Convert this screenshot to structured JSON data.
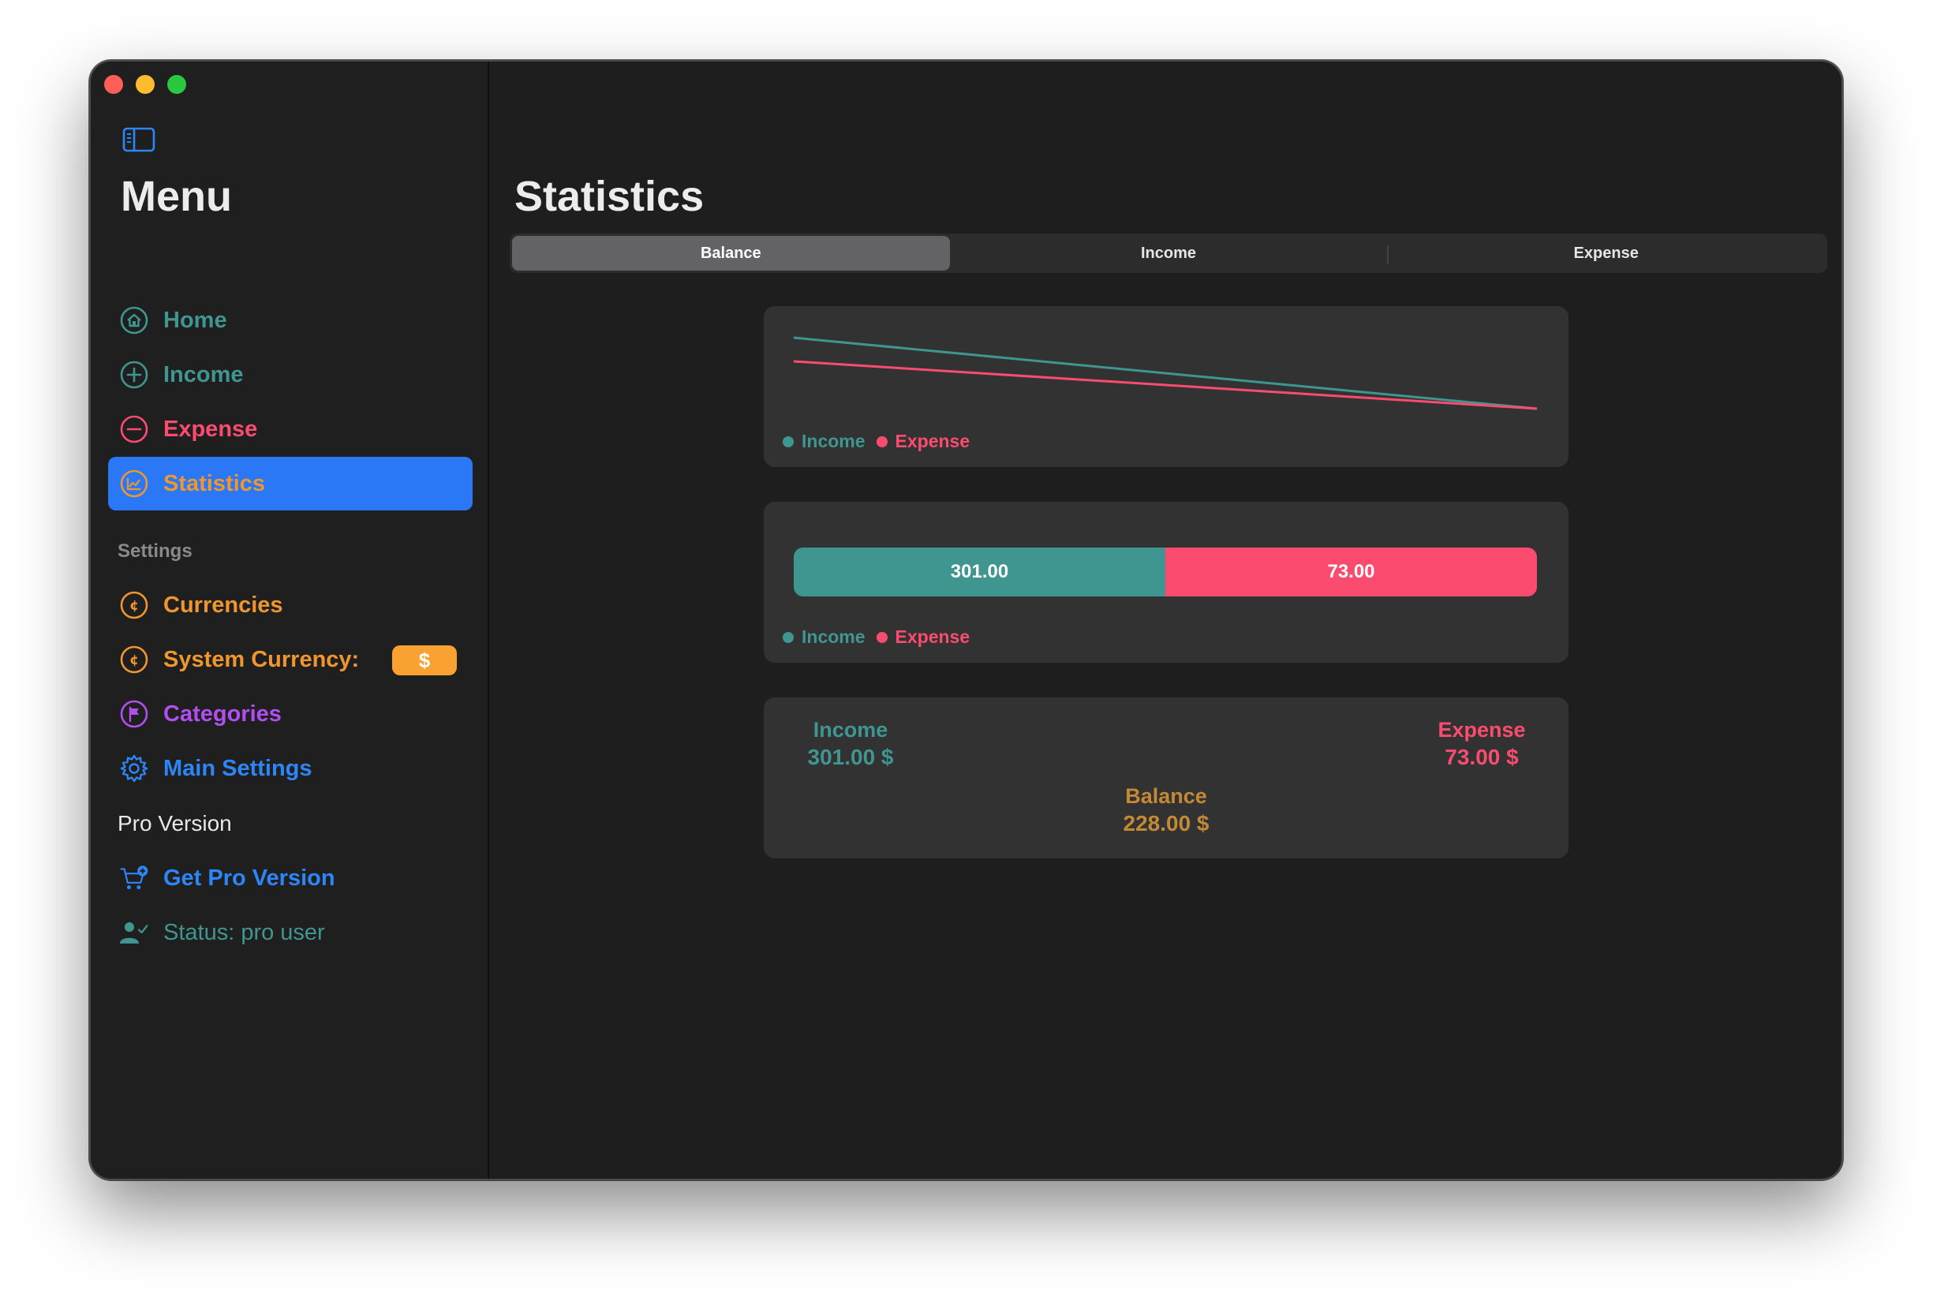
{
  "colors": {
    "income": "#3f9690",
    "expense": "#fb4c70",
    "orange": "#f0962e",
    "purple": "#b04ef0",
    "blue": "#2d86f7",
    "active": "#2a78f5",
    "balance": "#c48935"
  },
  "sidebar": {
    "title": "Menu",
    "items": [
      {
        "label": "Home",
        "icon": "house-circle-icon"
      },
      {
        "label": "Income",
        "icon": "plus-circle-icon"
      },
      {
        "label": "Expense",
        "icon": "minus-circle-icon"
      },
      {
        "label": "Statistics",
        "icon": "chart-circle-icon",
        "active": true
      }
    ],
    "settings_label": "Settings",
    "settings_items": [
      {
        "label": "Currencies",
        "icon": "cent-circle-icon"
      },
      {
        "label": "System Currency:",
        "icon": "cent-circle-icon",
        "badge": "$"
      },
      {
        "label": "Categories",
        "icon": "flag-circle-icon"
      },
      {
        "label": "Main Settings",
        "icon": "gear-icon"
      }
    ],
    "pro_label": "Pro Version",
    "pro_items": [
      {
        "label": "Get Pro Version",
        "icon": "cart-plus-icon"
      },
      {
        "label": "Status: pro user",
        "icon": "person-check-icon"
      }
    ]
  },
  "main": {
    "title": "Statistics",
    "tabs": [
      {
        "label": "Balance",
        "selected": true
      },
      {
        "label": "Income",
        "selected": false
      },
      {
        "label": "Expense",
        "selected": false
      }
    ],
    "legend": {
      "income": "Income",
      "expense": "Expense"
    },
    "summary": {
      "income_label": "Income",
      "income_value": "301.00 $",
      "expense_label": "Expense",
      "expense_value": "73.00 $",
      "balance_label": "Balance",
      "balance_value": "228.00 $"
    }
  },
  "chart_data": [
    {
      "type": "line",
      "x": [
        0,
        1
      ],
      "series": [
        {
          "name": "Income",
          "values": [
            301,
            0
          ]
        },
        {
          "name": "Expense",
          "values": [
            73,
            0
          ]
        }
      ]
    },
    {
      "type": "bar",
      "categories": [
        "Income",
        "Expense"
      ],
      "values": [
        301.0,
        73.0
      ],
      "labels": [
        "301.00",
        "73.00"
      ]
    }
  ]
}
